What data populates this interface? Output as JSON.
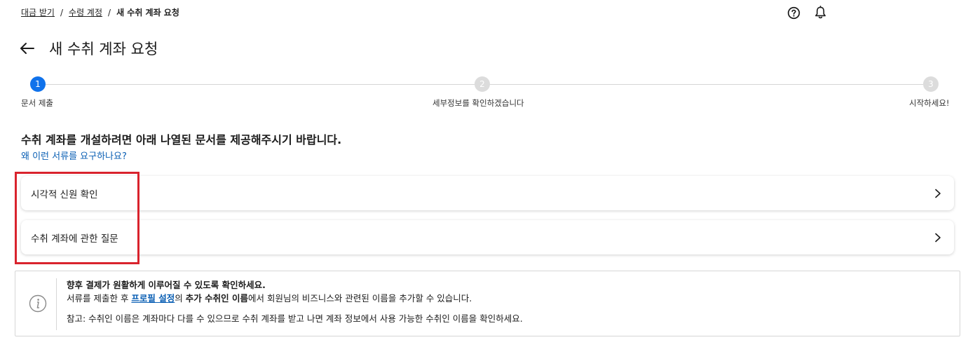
{
  "breadcrumb": {
    "item1": "대금 받기",
    "item2": "수령 계정",
    "current": "새 수취 계좌 요청",
    "separator": "/"
  },
  "header": {
    "title": "새 수취 계좌 요청",
    "icons": [
      "help-icon",
      "bell-icon",
      "back-arrow-icon"
    ]
  },
  "stepper": {
    "steps": [
      {
        "number": "1",
        "label": "문서 제출",
        "state": "active"
      },
      {
        "number": "2",
        "label": "세부정보를 확인하겠습니다",
        "state": "inactive"
      },
      {
        "number": "3",
        "label": "시작하세요!",
        "state": "inactive"
      }
    ]
  },
  "main": {
    "instruction": "수취 계좌를 개설하려면 아래 나열된 문서를 제공해주시기 바랍니다.",
    "why_link": "왜 이런 서류를 요구하나요?",
    "cards": [
      {
        "label": "시각적 신원 확인"
      },
      {
        "label": "수취 계좌에 관한 질문"
      }
    ]
  },
  "info": {
    "headline": "향후 결제가 원활하게 이루어질 수 있도록 확인하세요.",
    "line2_pre": "서류를 제출한 후 ",
    "line2_link": "프로필 설정",
    "line2_mid": "의 ",
    "line2_bold": "추가 수취인 이름",
    "line2_post": "에서 회원님의 비즈니스와 관련된 이름을 추가할 수 있습니다.",
    "note": "참고: 수취인 이름은 계좌마다 다를 수 있으므로 수취 계좌를 받고 나면 계좌 정보에서 사용 가능한 수취인 이름을 확인하세요."
  },
  "colors": {
    "accent": "#1072eb",
    "link": "#0a5fb4",
    "highlight": "#d9232d",
    "inactive_step": "#dcdcdc"
  }
}
